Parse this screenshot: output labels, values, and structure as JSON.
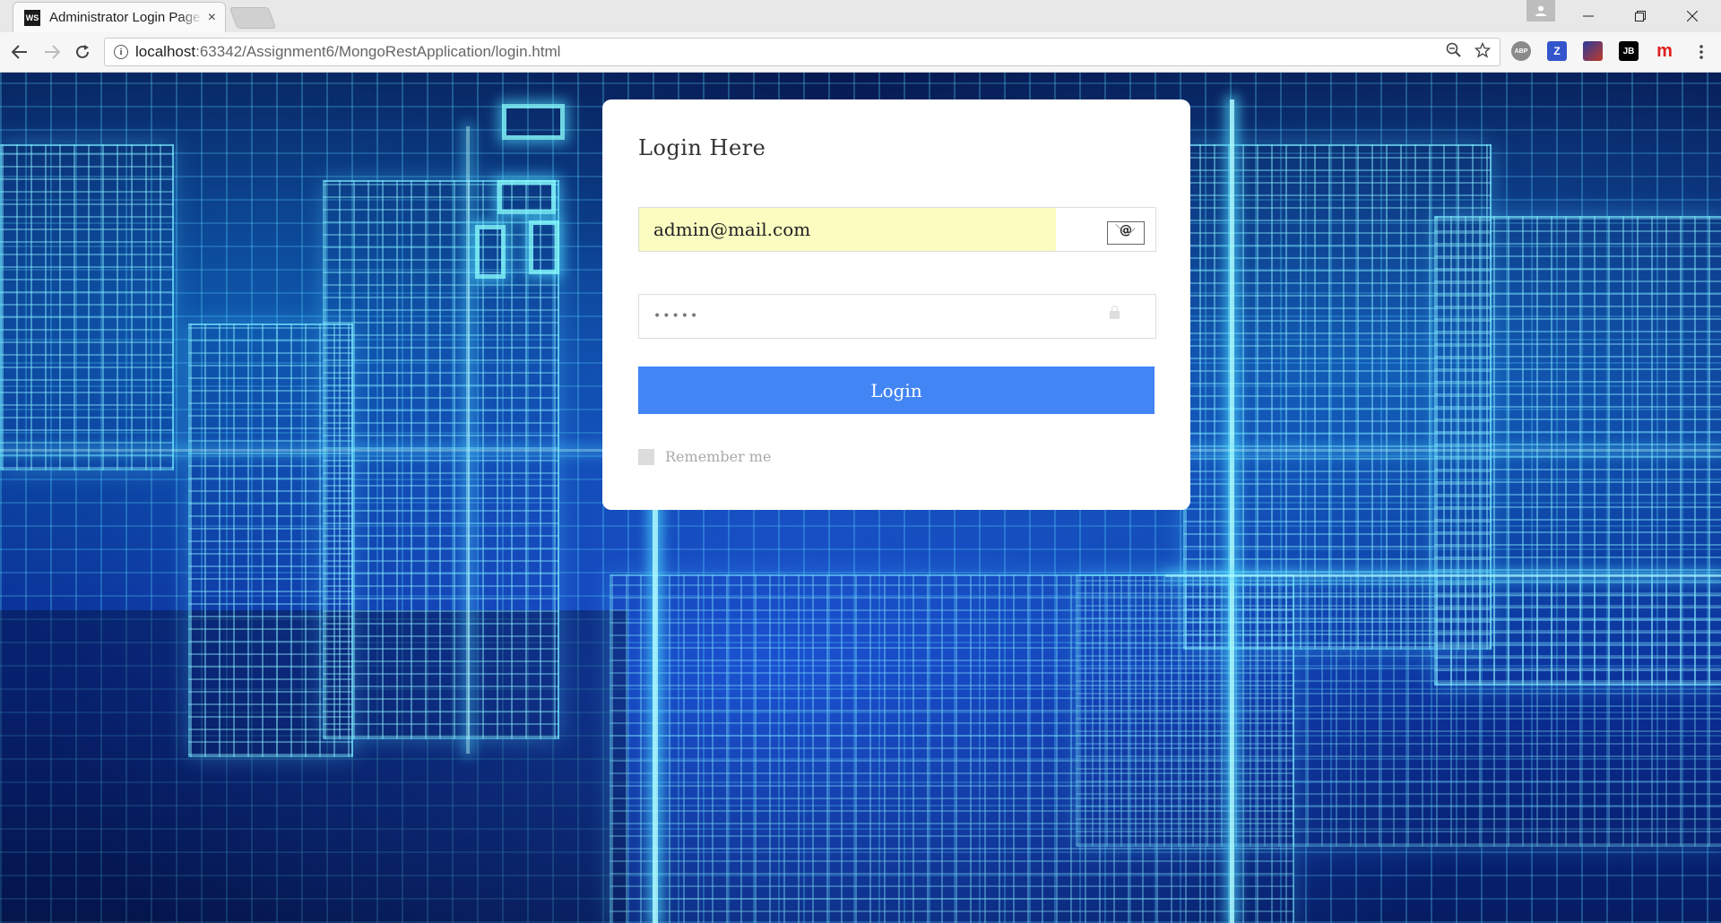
{
  "browser": {
    "tab_title": "Administrator Login Page",
    "tab_close": "×",
    "tab_icon_text": "WS",
    "url_host": "localhost",
    "url_path": ":63342/Assignment6/MongoRestApplication/login.html",
    "extensions": [
      {
        "name": "adblock-plus-icon",
        "text": "ABP",
        "color": "#888888"
      },
      {
        "name": "zotero-icon",
        "text": "Z",
        "color": "#3355cc"
      },
      {
        "name": "extension-icon",
        "text": "",
        "color": "#2a3a9a"
      },
      {
        "name": "jetbrains-icon",
        "text": "JB",
        "color": "#000000"
      },
      {
        "name": "m-extension-icon",
        "text": "m",
        "color": "#e02020"
      }
    ]
  },
  "login": {
    "title": "Login Here",
    "email_value": "admin@mail.com",
    "password_value": "•••••",
    "email_icon_glyph": "@",
    "button_label": "Login",
    "remember_label": "Remember me"
  }
}
